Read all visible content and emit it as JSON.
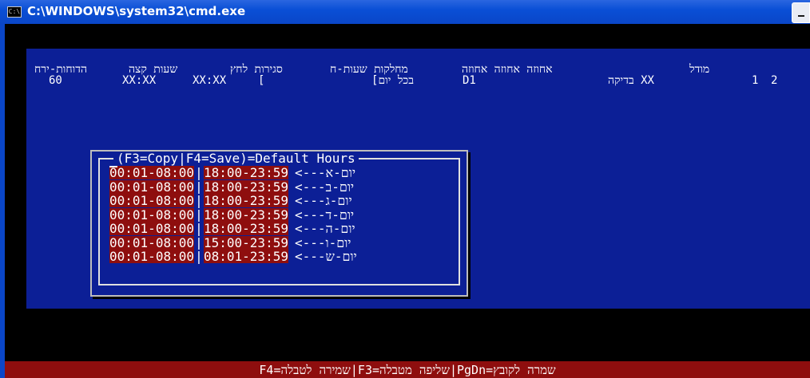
{
  "window": {
    "title": "C:\\WINDOWS\\system32\\cmd.exe",
    "icon": "console-icon"
  },
  "header": {
    "line1": {
      "col1": "הדוחות-ירח",
      "col2": "שעות קצה",
      "col3": "סגירות לחץ",
      "col4": "מחלקות שעות-ח",
      "col5": "אחוזה אחוזה אחוזה",
      "col6": "מודל"
    },
    "line2": {
      "col1": "60",
      "col2": "XX:XX",
      "col3": "XX:XX",
      "col4": "[",
      "col5": "[בכל יום",
      "col6": "D1",
      "col7": "בדיקה XX",
      "col8": "1",
      "col9": "2"
    }
  },
  "dialog": {
    "title": "(F3=Copy|F4=Save)=Default Hours",
    "rows": [
      {
        "a1": "00:01",
        "a2": "08:00",
        "b1": "18:00",
        "b2": "23:59",
        "day": "<---יום-א"
      },
      {
        "a1": "00:01",
        "a2": "08:00",
        "b1": "18:00",
        "b2": "23:59",
        "day": "<---יום-ב"
      },
      {
        "a1": "00:01",
        "a2": "08:00",
        "b1": "18:00",
        "b2": "23:59",
        "day": "<---יום-ג"
      },
      {
        "a1": "00:01",
        "a2": "08:00",
        "b1": "18:00",
        "b2": "23:59",
        "day": "<---יום-ד"
      },
      {
        "a1": "00:01",
        "a2": "08:00",
        "b1": "18:00",
        "b2": "23:59",
        "day": "<---יום-ה"
      },
      {
        "a1": "00:01",
        "a2": "08:00",
        "b1": "15:00",
        "b2": "23:59",
        "day": "<---יום-ו"
      },
      {
        "a1": "00:01",
        "a2": "08:00",
        "b1": "08:01",
        "b2": "23:59",
        "day": "<---יום-ש"
      }
    ]
  },
  "footer": {
    "text": "F4=שמירה לטבלה|F3=שליפה מטבלה|PgDn=שמרה לקובץ"
  },
  "colors": {
    "title_bar": "#0a46c8",
    "panel": "#0c1f96",
    "field": "#8e0e0e",
    "console": "#000000"
  }
}
